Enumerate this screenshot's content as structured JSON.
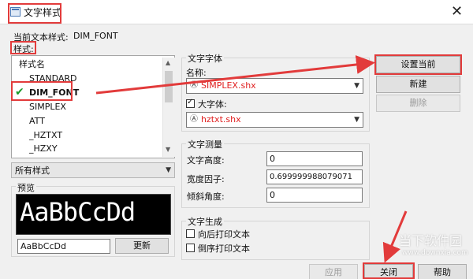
{
  "window": {
    "title": "文字样式",
    "close_glyph": "✕"
  },
  "current_style": {
    "label": "当前文本样式:",
    "value": "DIM_FONT"
  },
  "styles": {
    "label": "样式:",
    "header": "样式名",
    "items": [
      "STANDARD",
      "DIM_FONT",
      "SIMPLEX",
      "ATT",
      "_HZTXT",
      "_HZXY"
    ],
    "selected_index": 1,
    "selected_mark": "✔"
  },
  "filter": {
    "value": "所有样式"
  },
  "preview": {
    "label": "预览",
    "sample": "AaBbCcDd",
    "input_value": "AaBbCcDd",
    "update_button": "更新"
  },
  "font": {
    "group_label": "文字字体",
    "name_label": "名称:",
    "name_value": "SIMPLEX.shx",
    "bigfont_label": "大字体:",
    "bigfont_checked": true,
    "bigfont_value": "hztxt.shx",
    "value_color": "#e02020"
  },
  "measure": {
    "group_label": "文字测量",
    "height_label": "文字高度:",
    "height_value": "0",
    "width_label": "宽度因子:",
    "width_value": "0.699999988079071",
    "oblique_label": "倾斜角度:",
    "oblique_value": "0"
  },
  "generate": {
    "group_label": "文字生成",
    "backward_label": "向后打印文本",
    "backward_checked": false,
    "upside_label": "倒序打印文本",
    "upside_checked": false
  },
  "buttons": {
    "set_current": "设置当前",
    "new": "新建",
    "delete": "删除",
    "apply": "应用",
    "close": "关闭",
    "help": "帮助"
  },
  "watermark": {
    "brand": "当下软件园",
    "url": "www.downxia.com"
  },
  "icons": {
    "app": "window-icon",
    "font": "font-type-icon",
    "check": "checkmark-icon"
  },
  "annotation_color": "#e23b3b"
}
